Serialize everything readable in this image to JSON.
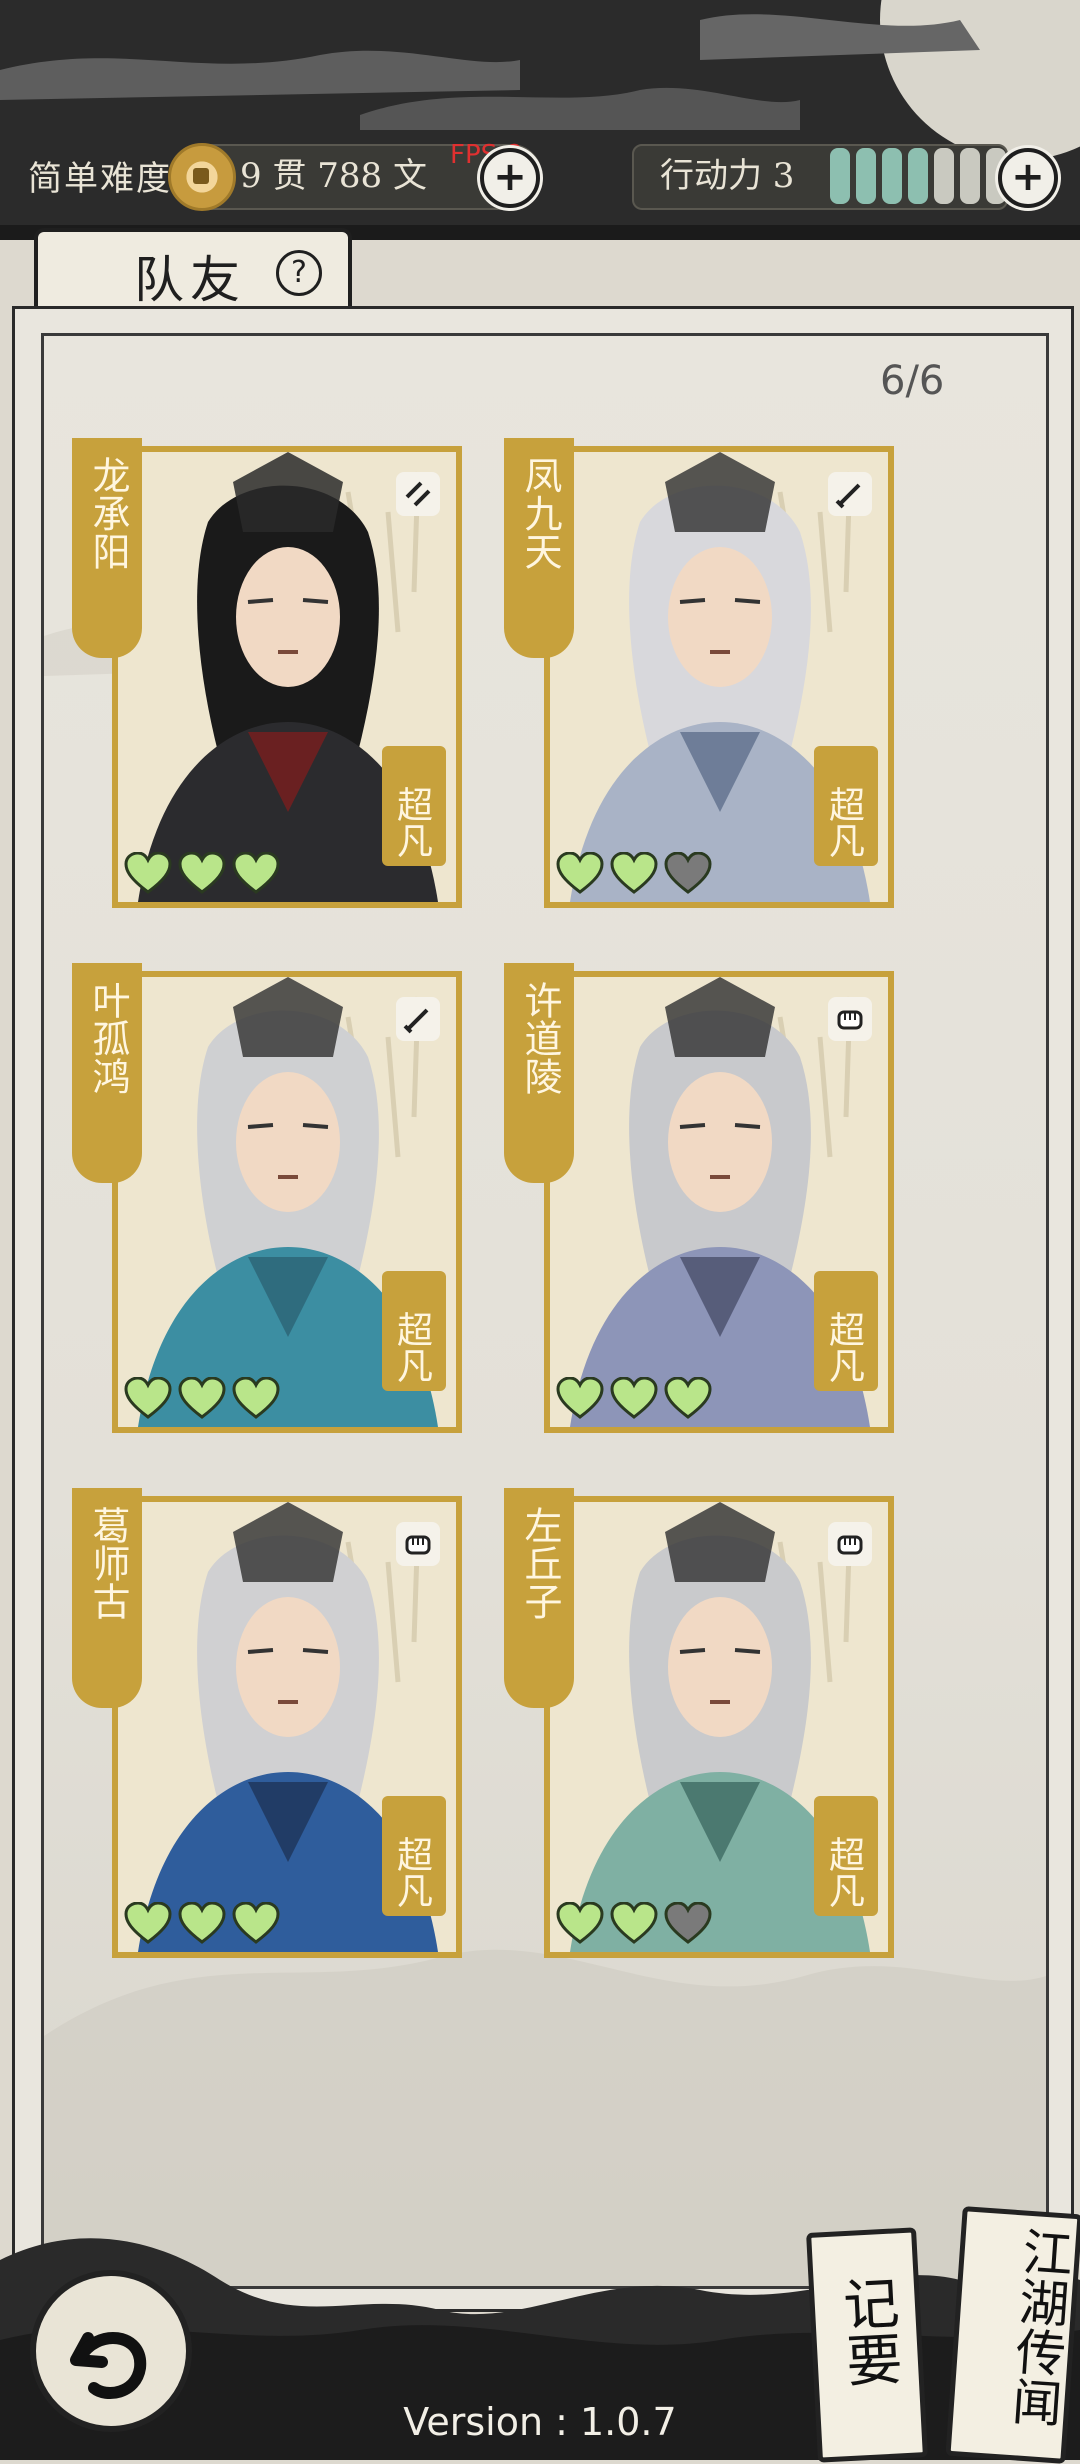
{
  "header": {
    "difficulty": "简单难度",
    "money": "9 贯  788  文",
    "fps": "FPS:8",
    "action_label": "行动力 3",
    "stamina": [
      1,
      1,
      1,
      1,
      0,
      0,
      0
    ]
  },
  "tab": {
    "label": "队友",
    "help": "?"
  },
  "team_count": "6/6",
  "cards": [
    {
      "name": "龙承阳",
      "rank": "超凡",
      "weapon": "double-blade-icon",
      "hearts": [
        1,
        1,
        1
      ],
      "robe": "#2b2b2e",
      "accent": "#7b1e1e",
      "hair": "#1a1a1a"
    },
    {
      "name": "凤九天",
      "rank": "超凡",
      "weapon": "sword-icon",
      "hearts": [
        1,
        1,
        0
      ],
      "robe": "#a9b3c6",
      "accent": "#5f6f8c",
      "hair": "#d8d8dc"
    },
    {
      "name": "叶孤鸿",
      "rank": "超凡",
      "weapon": "sword-icon",
      "hearts": [
        1,
        1,
        1
      ],
      "robe": "#3c8ea2",
      "accent": "#2c6475",
      "hair": "#cfd0d2"
    },
    {
      "name": "许道陵",
      "rank": "超凡",
      "weapon": "fist-icon",
      "hearts": [
        1,
        1,
        1
      ],
      "robe": "#8d95b8",
      "accent": "#4a4f6a",
      "hair": "#c8c9cc"
    },
    {
      "name": "葛师古",
      "rank": "超凡",
      "weapon": "fist-icon",
      "hearts": [
        1,
        1,
        1
      ],
      "robe": "#2f5d9c",
      "accent": "#1e3559",
      "hair": "#d0d0d2"
    },
    {
      "name": "左丘子",
      "rank": "超凡",
      "weapon": "fist-icon",
      "hearts": [
        1,
        1,
        0
      ],
      "robe": "#7fb0a3",
      "accent": "#3f6b63",
      "hair": "#c9cacc"
    }
  ],
  "footer": {
    "version": "Version : 1.0.7",
    "notes_button": "记要",
    "rumors_button": "江湖传闻"
  }
}
